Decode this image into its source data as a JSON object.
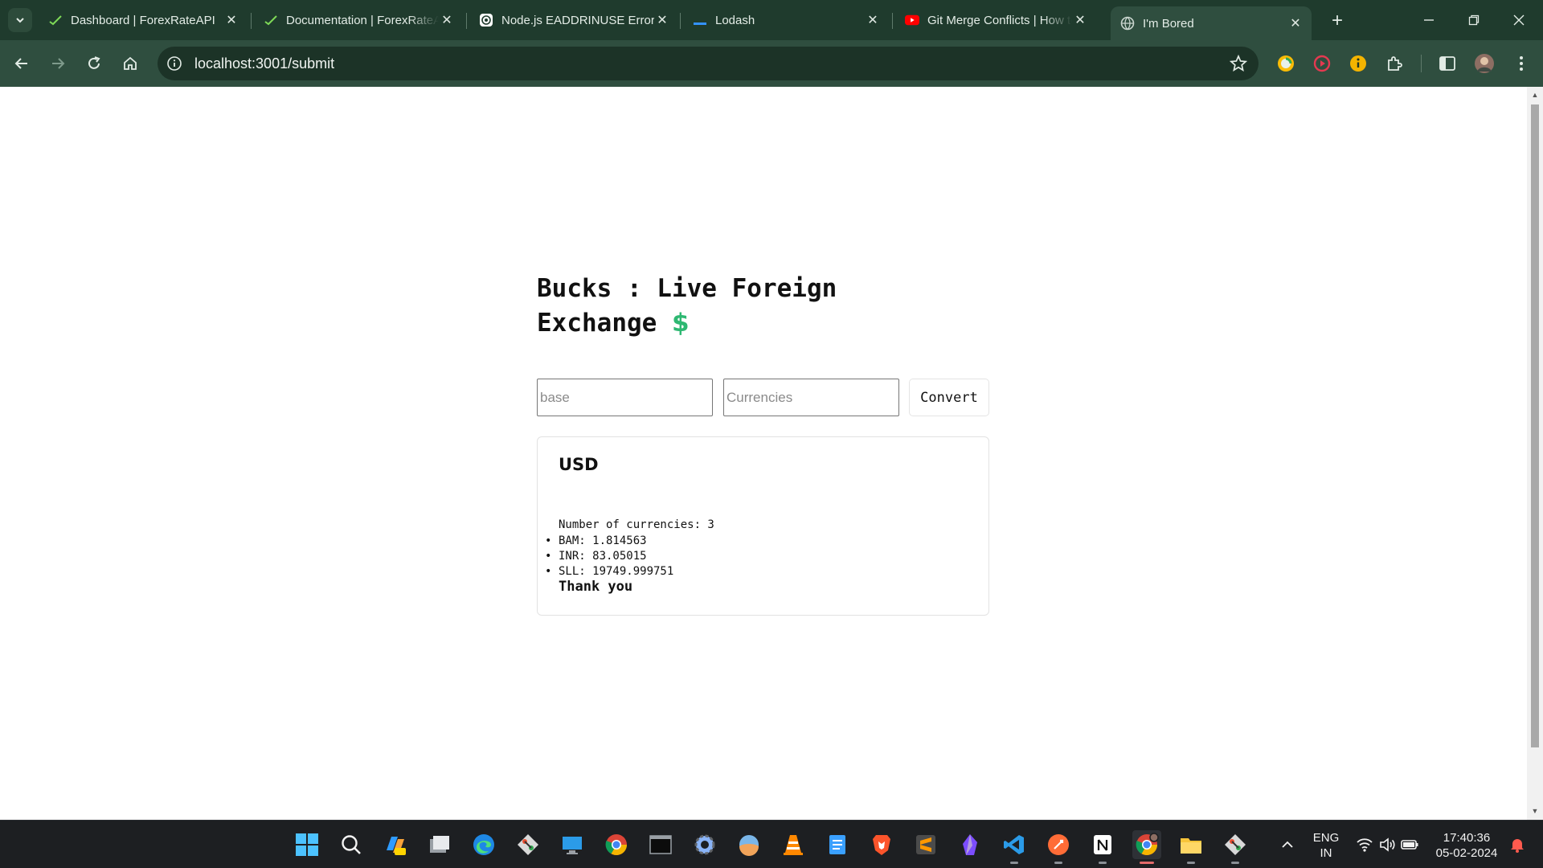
{
  "browser": {
    "tabs": [
      {
        "title": "Dashboard | ForexRateAPI",
        "icon": "forexrate-check-icon"
      },
      {
        "title": "Documentation | ForexRateAPI",
        "icon": "forexrate-check-icon"
      },
      {
        "title": "Node.js EADDRINUSE Error",
        "icon": "chatgpt-icon"
      },
      {
        "title": "Lodash",
        "icon": "lodash-icon"
      },
      {
        "title": "Git Merge Conflicts | How to",
        "icon": "youtube-icon"
      },
      {
        "title": "I'm Bored",
        "icon": "globe-icon",
        "active": true
      }
    ],
    "url": "localhost:3001/submit",
    "colors": {
      "frame": "#1f3b2d",
      "toolbar": "#2f4e3f",
      "omnibox": "#1c3327"
    }
  },
  "page": {
    "heading_line1": "Bucks : Live Foreign",
    "heading_line2": "Exchange",
    "heading_symbol": "$",
    "base_placeholder": "base",
    "currencies_placeholder": "Currencies",
    "convert_label": "Convert",
    "result": {
      "base": "USD",
      "count_text": "Number of currencies: 3",
      "rates": [
        {
          "code": "BAM",
          "value": "1.814563",
          "text": "BAM: 1.814563"
        },
        {
          "code": "INR",
          "value": "83.05015",
          "text": "INR: 83.05015"
        },
        {
          "code": "SLL",
          "value": "19749.999751",
          "text": "SLL: 19749.999751"
        }
      ],
      "footer": "Thank you"
    },
    "colors": {
      "accent": "#2eb872"
    }
  },
  "taskbar": {
    "apps": [
      "windows-start-icon",
      "search-icon",
      "copilot-icon",
      "task-view-icon",
      "edge-icon",
      "git-icon",
      "remote-desktop-icon",
      "chrome-icon",
      "terminal-icon",
      "settings-icon",
      "weather-icon",
      "vlc-icon",
      "notepad-icon",
      "brave-icon",
      "sublime-icon",
      "obsidian-icon",
      "vscode-icon",
      "postman-icon",
      "notion-icon",
      "chrome-profile-icon",
      "file-explorer-icon",
      "git-gui-icon"
    ],
    "language": "ENG",
    "region": "IN",
    "time": "17:40:36",
    "date": "05-02-2024"
  }
}
